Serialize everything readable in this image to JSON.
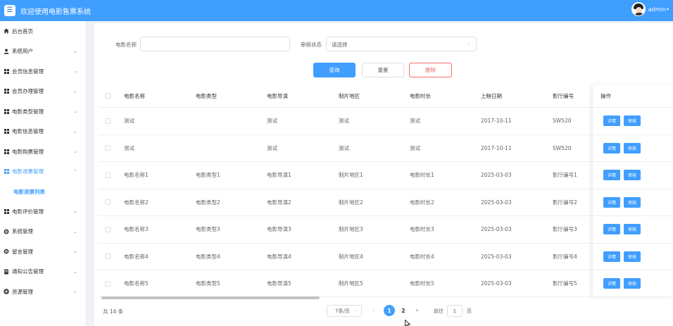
{
  "header": {
    "title": "欢迎使用电影售票系统",
    "username": "admin",
    "accent": "#409eff"
  },
  "sidebar": {
    "items": [
      {
        "label": "后台首页",
        "icon": "home-icon",
        "arrow": false
      },
      {
        "label": "系统用户",
        "icon": "user-icon",
        "arrow": true
      },
      {
        "label": "会员信息管理",
        "icon": "grid-icon",
        "arrow": true
      },
      {
        "label": "会员办理管理",
        "icon": "grid-icon",
        "arrow": true
      },
      {
        "label": "电影类型管理",
        "icon": "grid-icon",
        "arrow": true
      },
      {
        "label": "电影信息管理",
        "icon": "grid-icon",
        "arrow": true
      },
      {
        "label": "电影购票管理",
        "icon": "grid-icon",
        "arrow": true
      },
      {
        "label": "电影退票管理",
        "icon": "grid-icon",
        "arrow": true,
        "active": true
      },
      {
        "label": "电影退票列表",
        "sub": true
      },
      {
        "label": "电影评价管理",
        "icon": "grid-icon",
        "arrow": true
      },
      {
        "label": "系统管理",
        "icon": "gear-icon",
        "arrow": true
      },
      {
        "label": "留言管理",
        "icon": "gear-icon",
        "arrow": true
      },
      {
        "label": "通知公告管理",
        "icon": "document-icon",
        "arrow": true
      },
      {
        "label": "资源管理",
        "icon": "plus-circle-icon",
        "arrow": true
      }
    ]
  },
  "search": {
    "name_label": "电影名称",
    "name_value": "",
    "status_label": "审核状态",
    "status_placeholder": "请选择"
  },
  "buttons": {
    "query": "查询",
    "reset": "重置",
    "delete": "删除"
  },
  "table": {
    "columns": [
      "电影名称",
      "电影类型",
      "电影导演",
      "制片地区",
      "电影时长",
      "上映日期",
      "影厅编号",
      "操作"
    ],
    "rows": [
      [
        "测试",
        "",
        "测试",
        "测试",
        "测试",
        "2017-10-11",
        "SW520"
      ],
      [
        "测试",
        "",
        "测试",
        "测试",
        "测试",
        "2017-10-11",
        "SW520"
      ],
      [
        "电影名称1",
        "电影类型1",
        "电影导演1",
        "制片地区1",
        "电影时长1",
        "2025-03-03",
        "影厅编号1"
      ],
      [
        "电影名称2",
        "电影类型2",
        "电影导演2",
        "制片地区2",
        "电影时长2",
        "2025-03-03",
        "影厅编号2"
      ],
      [
        "电影名称3",
        "电影类型3",
        "电影导演3",
        "制片地区3",
        "电影时长3",
        "2025-03-03",
        "影厅编号3"
      ],
      [
        "电影名称4",
        "电影类型4",
        "电影导演4",
        "制片地区4",
        "电影时长4",
        "2025-03-03",
        "影厅编号4"
      ],
      [
        "电影名称5",
        "电影类型5",
        "电影导演5",
        "制片地区5",
        "电影时长5",
        "2025-03-03",
        "影厅编号5"
      ]
    ],
    "action_detail": "详情",
    "action_review": "审核"
  },
  "pagination": {
    "total": "共 14 条",
    "page_size": "7条/页",
    "pages": [
      "1",
      "2"
    ],
    "current": "1",
    "goto_prefix": "前往",
    "goto_value": "1",
    "goto_suffix": "页"
  }
}
